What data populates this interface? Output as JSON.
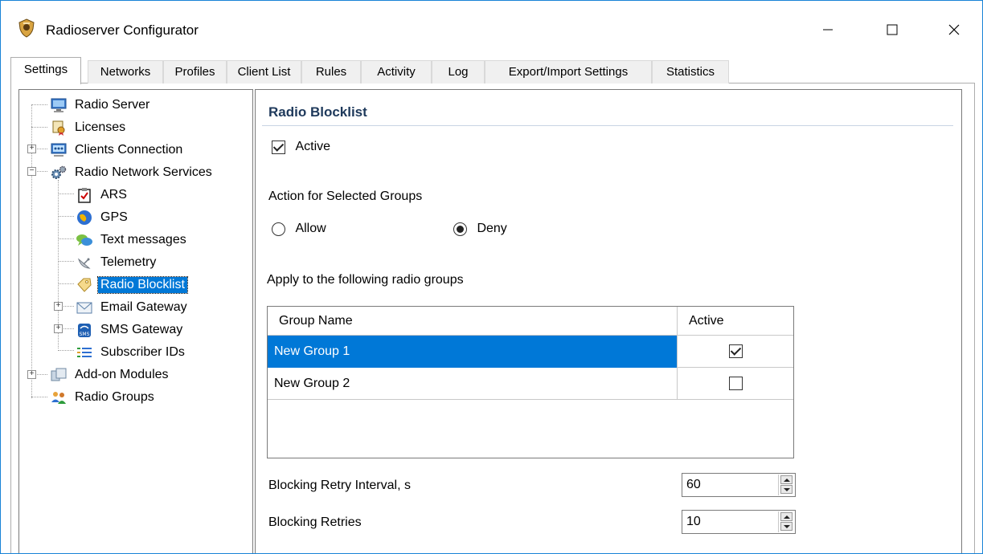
{
  "window": {
    "title": "Radioserver Configurator",
    "icons": {
      "app": "shield-app-icon",
      "minimize": "minimize-icon",
      "maximize": "maximize-icon",
      "close": "close-icon"
    }
  },
  "tabs": [
    {
      "label": "Settings",
      "active": true
    },
    {
      "label": "Networks"
    },
    {
      "label": "Profiles"
    },
    {
      "label": "Client List"
    },
    {
      "label": "Rules"
    },
    {
      "label": "Activity"
    },
    {
      "label": "Log"
    },
    {
      "label": "Export/Import Settings"
    },
    {
      "label": "Statistics"
    }
  ],
  "tree": {
    "items": [
      {
        "label": "Radio Server",
        "icon": "server-monitor-icon"
      },
      {
        "label": "Licenses",
        "icon": "license-certificate-icon"
      },
      {
        "label": "Clients Connection",
        "icon": "network-monitor-icon",
        "expandable": true
      },
      {
        "label": "Radio Network Services",
        "icon": "gears-icon",
        "expanded": true
      },
      {
        "label": "ARS",
        "icon": "clipboard-check-icon"
      },
      {
        "label": "GPS",
        "icon": "globe-icon"
      },
      {
        "label": "Text messages",
        "icon": "speech-bubbles-icon"
      },
      {
        "label": "Telemetry",
        "icon": "satellite-dish-icon"
      },
      {
        "label": "Radio Blocklist",
        "icon": "tag-icon",
        "selected": true
      },
      {
        "label": "Email Gateway",
        "icon": "envelope-icon",
        "expandable": true
      },
      {
        "label": "SMS Gateway",
        "icon": "sms-icon",
        "expandable": true
      },
      {
        "label": "Subscriber IDs",
        "icon": "id-list-icon"
      },
      {
        "label": "Add-on Modules",
        "icon": "modules-icon",
        "expandable": true
      },
      {
        "label": "Radio Groups",
        "icon": "people-group-icon"
      }
    ]
  },
  "panel": {
    "title": "Radio Blocklist",
    "active_label": "Active",
    "active_checked": true,
    "action_label": "Action for Selected Groups",
    "allow_label": "Allow",
    "deny_label": "Deny",
    "selected_action": "Deny",
    "apply_label": "Apply to the following radio groups",
    "grid": {
      "columns": [
        "Group Name",
        "Active"
      ],
      "rows": [
        {
          "name": "New Group 1",
          "active": true,
          "selected": true
        },
        {
          "name": "New Group 2",
          "active": false,
          "selected": false
        }
      ]
    },
    "retry_interval_label": "Blocking Retry Interval, s",
    "retry_interval_value": "60",
    "retries_label": "Blocking Retries",
    "retries_value": "10"
  },
  "colors": {
    "selection": "#0078d7",
    "section_title": "#1e395b",
    "window_border": "#1883d7"
  }
}
